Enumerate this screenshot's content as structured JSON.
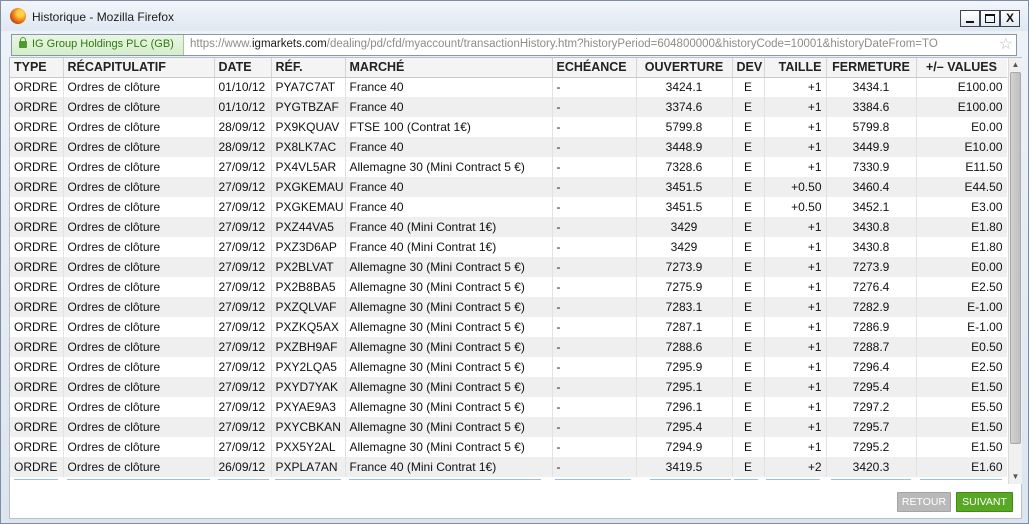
{
  "window": {
    "title": "Historique - Mozilla Firefox",
    "controls": {
      "minimize": "",
      "maximize": "",
      "close": "X"
    }
  },
  "urlbar": {
    "identity": "IG Group Holdings PLC (GB)",
    "url_prefix": "https://www.",
    "url_domain": "igmarkets.com",
    "url_rest": "/dealing/pd/cfd/myaccount/transactionHistory.htm?historyPeriod=604800000&historyCode=10001&historyDateFrom=TO"
  },
  "table": {
    "headers": [
      "TYPE",
      "RÉCAPITULATIF",
      "DATE",
      "RÉF.",
      "MARCHÉ",
      "ECHÉANCE",
      "OUVERTURE",
      "DEV",
      "TAILLE",
      "FERMETURE",
      "+/– VALUES"
    ],
    "rows": [
      [
        "ORDRE",
        "Ordres de clôture",
        "01/10/12",
        "PYA7C7AT",
        "France 40",
        "-",
        "3424.1",
        "E",
        "+1",
        "3434.1",
        "E100.00"
      ],
      [
        "ORDRE",
        "Ordres de clôture",
        "01/10/12",
        "PYGTBZAF",
        "France 40",
        "-",
        "3374.6",
        "E",
        "+1",
        "3384.6",
        "E100.00"
      ],
      [
        "ORDRE",
        "Ordres de clôture",
        "28/09/12",
        "PX9KQUAV",
        "FTSE 100 (Contrat 1€)",
        "-",
        "5799.8",
        "E",
        "+1",
        "5799.8",
        "E0.00"
      ],
      [
        "ORDRE",
        "Ordres de clôture",
        "28/09/12",
        "PX8LK7AC",
        "France 40",
        "-",
        "3448.9",
        "E",
        "+1",
        "3449.9",
        "E10.00"
      ],
      [
        "ORDRE",
        "Ordres de clôture",
        "27/09/12",
        "PX4VL5AR",
        "Allemagne 30 (Mini Contract 5 €)",
        "-",
        "7328.6",
        "E",
        "+1",
        "7330.9",
        "E11.50"
      ],
      [
        "ORDRE",
        "Ordres de clôture",
        "27/09/12",
        "PXGKEMAU",
        "France 40",
        "-",
        "3451.5",
        "E",
        "+0.50",
        "3460.4",
        "E44.50"
      ],
      [
        "ORDRE",
        "Ordres de clôture",
        "27/09/12",
        "PXGKEMAU",
        "France 40",
        "-",
        "3451.5",
        "E",
        "+0.50",
        "3452.1",
        "E3.00"
      ],
      [
        "ORDRE",
        "Ordres de clôture",
        "27/09/12",
        "PXZ44VA5",
        "France 40 (Mini Contrat 1€)",
        "-",
        "3429",
        "E",
        "+1",
        "3430.8",
        "E1.80"
      ],
      [
        "ORDRE",
        "Ordres de clôture",
        "27/09/12",
        "PXZ3D6AP",
        "France 40 (Mini Contrat 1€)",
        "-",
        "3429",
        "E",
        "+1",
        "3430.8",
        "E1.80"
      ],
      [
        "ORDRE",
        "Ordres de clôture",
        "27/09/12",
        "PX2BLVAT",
        "Allemagne 30 (Mini Contract 5 €)",
        "-",
        "7273.9",
        "E",
        "+1",
        "7273.9",
        "E0.00"
      ],
      [
        "ORDRE",
        "Ordres de clôture",
        "27/09/12",
        "PX2B8BA5",
        "Allemagne 30 (Mini Contract 5 €)",
        "-",
        "7275.9",
        "E",
        "+1",
        "7276.4",
        "E2.50"
      ],
      [
        "ORDRE",
        "Ordres de clôture",
        "27/09/12",
        "PXZQLVAF",
        "Allemagne 30 (Mini Contract 5 €)",
        "-",
        "7283.1",
        "E",
        "+1",
        "7282.9",
        "E-1.00"
      ],
      [
        "ORDRE",
        "Ordres de clôture",
        "27/09/12",
        "PXZKQ5AX",
        "Allemagne 30 (Mini Contract 5 €)",
        "-",
        "7287.1",
        "E",
        "+1",
        "7286.9",
        "E-1.00"
      ],
      [
        "ORDRE",
        "Ordres de clôture",
        "27/09/12",
        "PXZBH9AF",
        "Allemagne 30 (Mini Contract 5 €)",
        "-",
        "7288.6",
        "E",
        "+1",
        "7288.7",
        "E0.50"
      ],
      [
        "ORDRE",
        "Ordres de clôture",
        "27/09/12",
        "PXY2LQA5",
        "Allemagne 30 (Mini Contract 5 €)",
        "-",
        "7295.9",
        "E",
        "+1",
        "7296.4",
        "E2.50"
      ],
      [
        "ORDRE",
        "Ordres de clôture",
        "27/09/12",
        "PXYD7YAK",
        "Allemagne 30 (Mini Contract 5 €)",
        "-",
        "7295.1",
        "E",
        "+1",
        "7295.4",
        "E1.50"
      ],
      [
        "ORDRE",
        "Ordres de clôture",
        "27/09/12",
        "PXYAE9A3",
        "Allemagne 30 (Mini Contract 5 €)",
        "-",
        "7296.1",
        "E",
        "+1",
        "7297.2",
        "E5.50"
      ],
      [
        "ORDRE",
        "Ordres de clôture",
        "27/09/12",
        "PXYCBKAN",
        "Allemagne 30 (Mini Contract 5 €)",
        "-",
        "7295.4",
        "E",
        "+1",
        "7295.7",
        "E1.50"
      ],
      [
        "ORDRE",
        "Ordres de clôture",
        "27/09/12",
        "PXX5Y2AL",
        "Allemagne 30 (Mini Contract 5 €)",
        "-",
        "7294.9",
        "E",
        "+1",
        "7295.2",
        "E1.50"
      ],
      [
        "ORDRE",
        "Ordres de clôture",
        "26/09/12",
        "PXPLA7AN",
        "France 40 (Mini Contrat 1€)",
        "-",
        "3419.5",
        "E",
        "+2",
        "3420.3",
        "E1.60"
      ]
    ]
  },
  "pagination": {
    "prev_label": "RETOUR",
    "next_label": "SUIVANT"
  },
  "colors": {
    "accent_green": "#58a826",
    "disabled_gray": "#b9b9b9",
    "identity_green": "#2d7a10"
  },
  "icons": [
    "firefox-logo-icon",
    "lock-icon",
    "star-icon"
  ]
}
